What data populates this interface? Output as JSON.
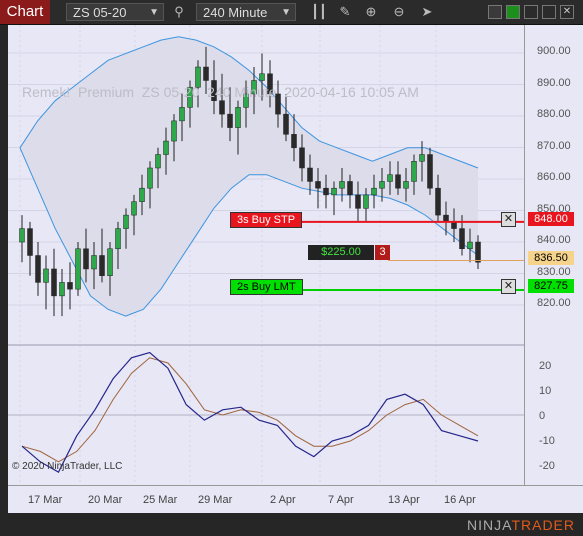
{
  "toolbar": {
    "chart_tab": "Chart",
    "instrument": "ZS 05-20",
    "interval": "240 Minute",
    "icons": [
      "search-icon",
      "bar-type-icon",
      "draw-icon",
      "zoom-in-icon",
      "zoom-out-icon",
      "cursor-icon"
    ]
  },
  "overlay_text": "Remek!  Premium  ZS 05-20  240 Minute  2020-04-16 10:05 AM",
  "copyright": "© 2020 NinjaTrader, LLC",
  "brand": {
    "first": "NINJA",
    "second": "TRADER"
  },
  "orders": {
    "stop": {
      "label": "3s  Buy STP",
      "price": "848.00",
      "color": "#e8141e"
    },
    "limit": {
      "label": "2s  Buy LMT",
      "price": "827.75",
      "color": "#00e000"
    },
    "position": {
      "pnl": "$225.00",
      "qty": "3",
      "price": "836.50",
      "color": "#f6d38a"
    }
  },
  "price_axis": [
    "900.00",
    "890.00",
    "880.00",
    "870.00",
    "860.00",
    "850.00",
    "840.00",
    "830.00",
    "820.00"
  ],
  "osc_axis": [
    "20",
    "10",
    "0",
    "-10",
    "-20"
  ],
  "x_axis": [
    "17 Mar",
    "20 Mar",
    "25 Mar",
    "29 Mar",
    "2 Apr",
    "7 Apr",
    "13 Apr",
    "16 Apr"
  ],
  "chart_data": {
    "type": "candlestick",
    "y_range": [
      812,
      905
    ],
    "osc_range": [
      -25,
      25
    ],
    "candles": [
      [
        842,
        850,
        836,
        846
      ],
      [
        846,
        848,
        832,
        838
      ],
      [
        838,
        842,
        826,
        830
      ],
      [
        830,
        838,
        822,
        834
      ],
      [
        834,
        840,
        820,
        826
      ],
      [
        826,
        834,
        820,
        830
      ],
      [
        830,
        836,
        822,
        828
      ],
      [
        828,
        842,
        826,
        840
      ],
      [
        840,
        846,
        830,
        834
      ],
      [
        834,
        842,
        828,
        838
      ],
      [
        838,
        846,
        830,
        832
      ],
      [
        832,
        842,
        826,
        840
      ],
      [
        840,
        848,
        834,
        846
      ],
      [
        846,
        852,
        840,
        850
      ],
      [
        850,
        856,
        844,
        854
      ],
      [
        854,
        862,
        850,
        858
      ],
      [
        858,
        866,
        852,
        864
      ],
      [
        864,
        870,
        858,
        868
      ],
      [
        868,
        876,
        862,
        872
      ],
      [
        872,
        880,
        866,
        878
      ],
      [
        878,
        886,
        872,
        882
      ],
      [
        882,
        890,
        876,
        888
      ],
      [
        888,
        896,
        882,
        894
      ],
      [
        894,
        900,
        886,
        890
      ],
      [
        890,
        896,
        880,
        884
      ],
      [
        884,
        892,
        876,
        880
      ],
      [
        880,
        888,
        872,
        876
      ],
      [
        876,
        884,
        868,
        882
      ],
      [
        882,
        890,
        876,
        886
      ],
      [
        886,
        894,
        880,
        890
      ],
      [
        890,
        898,
        884,
        892
      ],
      [
        892,
        896,
        882,
        886
      ],
      [
        886,
        890,
        876,
        880
      ],
      [
        880,
        886,
        872,
        874
      ],
      [
        874,
        880,
        866,
        870
      ],
      [
        870,
        874,
        860,
        864
      ],
      [
        864,
        868,
        856,
        860
      ],
      [
        860,
        864,
        852,
        858
      ],
      [
        858,
        862,
        852,
        856
      ],
      [
        856,
        860,
        850,
        858
      ],
      [
        858,
        864,
        854,
        860
      ],
      [
        860,
        862,
        852,
        856
      ],
      [
        856,
        860,
        848,
        852
      ],
      [
        852,
        858,
        848,
        856
      ],
      [
        856,
        862,
        852,
        858
      ],
      [
        858,
        864,
        854,
        860
      ],
      [
        860,
        866,
        856,
        862
      ],
      [
        862,
        866,
        856,
        858
      ],
      [
        858,
        864,
        854,
        860
      ],
      [
        860,
        868,
        856,
        866
      ],
      [
        866,
        872,
        860,
        868
      ],
      [
        868,
        870,
        856,
        858
      ],
      [
        858,
        862,
        848,
        850
      ],
      [
        850,
        854,
        844,
        848
      ],
      [
        848,
        852,
        842,
        846
      ],
      [
        846,
        850,
        838,
        840
      ],
      [
        840,
        846,
        836,
        842
      ],
      [
        842,
        844,
        834,
        836
      ]
    ],
    "bollinger_upper": [
      870,
      878,
      884,
      888,
      892,
      896,
      898,
      900,
      902,
      903,
      902,
      900,
      897,
      893,
      888,
      882,
      876,
      872,
      870,
      868,
      866,
      868,
      870,
      870,
      868,
      866,
      864
    ],
    "bollinger_lower": [
      870,
      858,
      846,
      836,
      826,
      822,
      820,
      822,
      828,
      836,
      844,
      852,
      858,
      862,
      862,
      860,
      858,
      857,
      856,
      856,
      856,
      855,
      853,
      850,
      846,
      842,
      838
    ],
    "osc_series_1": [
      -12,
      -18,
      -22,
      -8,
      2,
      14,
      22,
      24,
      18,
      4,
      -2,
      2,
      3,
      -2,
      -4,
      -12,
      -16,
      -10,
      -8,
      -4,
      6,
      8,
      4,
      -6,
      -8,
      -10
    ],
    "osc_series_2": [
      -12,
      -14,
      -18,
      -14,
      -6,
      6,
      16,
      22,
      20,
      12,
      2,
      0,
      2,
      1,
      -2,
      -8,
      -12,
      -12,
      -10,
      -6,
      0,
      4,
      6,
      0,
      -4,
      -8
    ]
  }
}
